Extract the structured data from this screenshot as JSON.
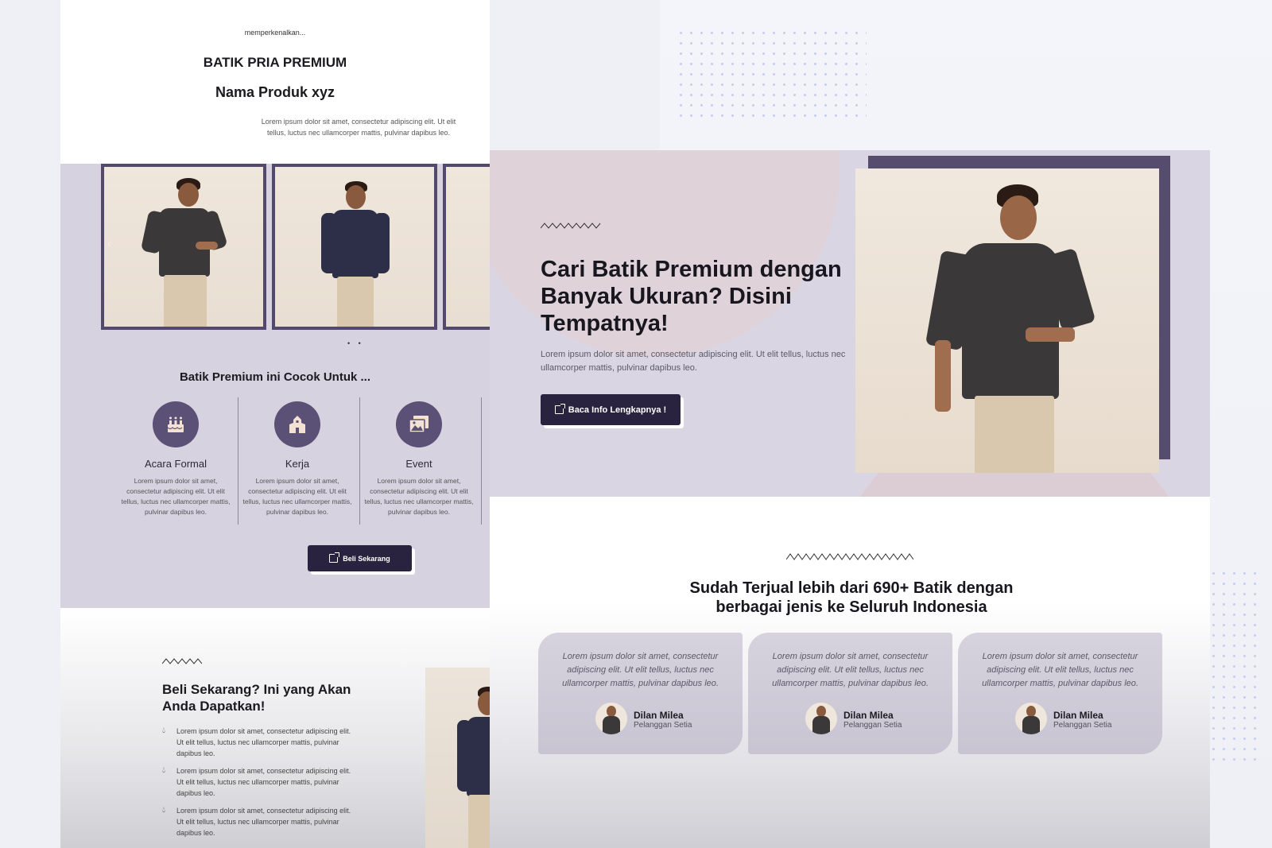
{
  "left_page": {
    "eyebrow": "memperkenalkan...",
    "title": "BATIK PRIA PREMIUM",
    "product_name": "Nama Produk xyz",
    "description": "Lorem ipsum dolor sit amet, consectetur adipiscing elit. Ut elit tellus, luctus nec ullamcorper mattis, pulvinar dapibus leo.",
    "carousel": {
      "prev_icon": "chevron-left-icon",
      "dots": "• •"
    },
    "suits_title": "Batik Premium ini Cocok Untuk ...",
    "features": [
      {
        "name": "Acara Formal",
        "icon": "cake-icon",
        "text": "Lorem ipsum dolor sit amet, consectetur adipiscing elit. Ut elit tellus, luctus nec ullamcorper mattis, pulvinar dapibus leo."
      },
      {
        "name": "Kerja",
        "icon": "office-building-icon",
        "text": "Lorem ipsum dolor sit amet, consectetur adipiscing elit. Ut elit tellus, luctus nec ullamcorper mattis, pulvinar dapibus leo."
      },
      {
        "name": "Event",
        "icon": "photo-gallery-icon",
        "text": "Lorem ipsum dolor sit amet, consectetur adipiscing elit. Ut elit tellus, luctus nec ullamcorper mattis, pulvinar dapibus leo."
      }
    ],
    "buy_button": "Beli Sekarang",
    "bottom_title": "Beli Sekarang? Ini yang Akan Anda Dapatkan!",
    "benefits": [
      "Lorem ipsum dolor sit amet, consectetur adipiscing elit. Ut elit tellus, luctus nec ullamcorper mattis, pulvinar dapibus leo.",
      "Lorem ipsum dolor sit amet, consectetur adipiscing elit. Ut elit tellus, luctus nec ullamcorper mattis, pulvinar dapibus leo.",
      "Lorem ipsum dolor sit amet, consectetur adipiscing elit. Ut elit tellus, luctus nec ullamcorper mattis, pulvinar dapibus leo."
    ]
  },
  "right_page": {
    "hero_title": "Cari Batik Premium dengan Banyak Ukuran? Disini Tempatnya!",
    "hero_desc": "Lorem ipsum dolor sit amet, consectetur adipiscing elit. Ut elit tellus, luctus nec ullamcorper mattis, pulvinar dapibus leo.",
    "hero_button": "Baca Info Lengkapnya !",
    "sold_title": "Sudah Terjual lebih dari 690+ Batik dengan berbagai jenis ke Seluruh Indonesia",
    "testimonials": [
      {
        "text": "Lorem ipsum dolor sit amet, consectetur adipiscing elit. Ut elit tellus, luctus nec ullamcorper mattis, pulvinar dapibus leo.",
        "name": "Dilan Milea",
        "role": "Pelanggan Setia"
      },
      {
        "text": "Lorem ipsum dolor sit amet, consectetur adipiscing elit. Ut elit tellus, luctus nec ullamcorper mattis, pulvinar dapibus leo.",
        "name": "Dilan Milea",
        "role": "Pelanggan Setia"
      },
      {
        "text": "Lorem ipsum dolor sit amet, consectetur adipiscing elit. Ut elit tellus, luctus nec ullamcorper mattis, pulvinar dapibus leo.",
        "name": "Dilan Milea",
        "role": "Pelanggan Setia"
      }
    ]
  },
  "colors": {
    "brand_dark": "#2a2340",
    "brand_purple": "#564d6e",
    "section_lavender": "#d9d5e2",
    "accent_pink": "#e0d1d8"
  }
}
